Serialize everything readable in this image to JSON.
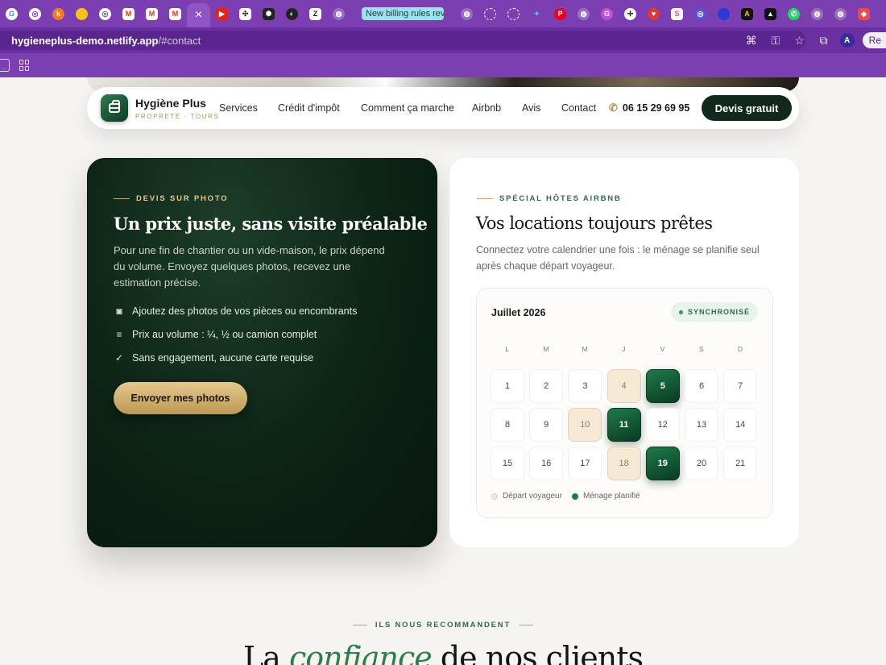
{
  "browser": {
    "tab_group_label": "New billing rules rev",
    "url_host": "hygieneplus-demo.netlify.app",
    "url_path": "/#contact",
    "profile_initial": "A",
    "relaunch_label": "Re"
  },
  "nav": {
    "brand_name": "Hygiène Plus",
    "brand_tagline": "PROPRETÉ · TOURS",
    "links": [
      "Services",
      "Crédit d'impôt",
      "Comment ça marche",
      "Airbnb",
      "Avis",
      "Contact"
    ],
    "phone": "06 15 29 69 95",
    "cta_label": "Devis gratuit"
  },
  "photo_quote": {
    "eyebrow": "DEVIS SUR PHOTO",
    "title": "Un prix juste, sans visite préalable",
    "description": "Pour une fin de chantier ou un vide-maison, le prix dépend du volume. Envoyez quelques photos, recevez une estimation précise.",
    "features": [
      {
        "icon": "camera-icon",
        "text": "Ajoutez des photos de vos pièces ou encombrants"
      },
      {
        "icon": "lines-icon",
        "text": "Prix au volume : ¼, ½ ou camion complet"
      },
      {
        "icon": "check-icon",
        "text": "Sans engagement, aucune carte requise"
      }
    ],
    "button_label": "Envoyer mes photos"
  },
  "airbnb": {
    "eyebrow": "SPÉCIAL HÔTES AIRBNB",
    "title": "Vos locations toujours prêtes",
    "description": "Connectez votre calendrier une fois : le ménage se planifie seul après chaque départ voyageur.",
    "calendar": {
      "month": "Juillet 2026",
      "status": "SYNCHRONISÉ",
      "weekdays": [
        "L",
        "M",
        "M",
        "J",
        "V",
        "S",
        "D"
      ],
      "days": [
        {
          "n": "1",
          "state": "normal"
        },
        {
          "n": "2",
          "state": "normal"
        },
        {
          "n": "3",
          "state": "normal"
        },
        {
          "n": "4",
          "state": "departure"
        },
        {
          "n": "5",
          "state": "cleaning"
        },
        {
          "n": "6",
          "state": "normal"
        },
        {
          "n": "7",
          "state": "normal"
        },
        {
          "n": "8",
          "state": "normal"
        },
        {
          "n": "9",
          "state": "normal"
        },
        {
          "n": "10",
          "state": "departure"
        },
        {
          "n": "11",
          "state": "cleaning"
        },
        {
          "n": "12",
          "state": "normal"
        },
        {
          "n": "13",
          "state": "normal"
        },
        {
          "n": "14",
          "state": "normal"
        },
        {
          "n": "15",
          "state": "normal"
        },
        {
          "n": "16",
          "state": "normal"
        },
        {
          "n": "17",
          "state": "normal"
        },
        {
          "n": "18",
          "state": "departure"
        },
        {
          "n": "19",
          "state": "cleaning"
        },
        {
          "n": "20",
          "state": "normal"
        },
        {
          "n": "21",
          "state": "normal"
        }
      ],
      "legend": [
        {
          "label": "Départ voyageur",
          "color": "#f6ead6"
        },
        {
          "label": "Ménage planifié",
          "color": "#1f7a4a"
        }
      ]
    }
  },
  "testimonials": {
    "eyebrow": "ILS NOUS RECOMMANDENT",
    "title_before": "La ",
    "title_emphasis": "confiance",
    "title_after": " de nos clients"
  },
  "colors": {
    "brand_green": "#0f2a1c",
    "accent_gold": "#c9a461",
    "browser_purple": "#7b3fb1"
  }
}
